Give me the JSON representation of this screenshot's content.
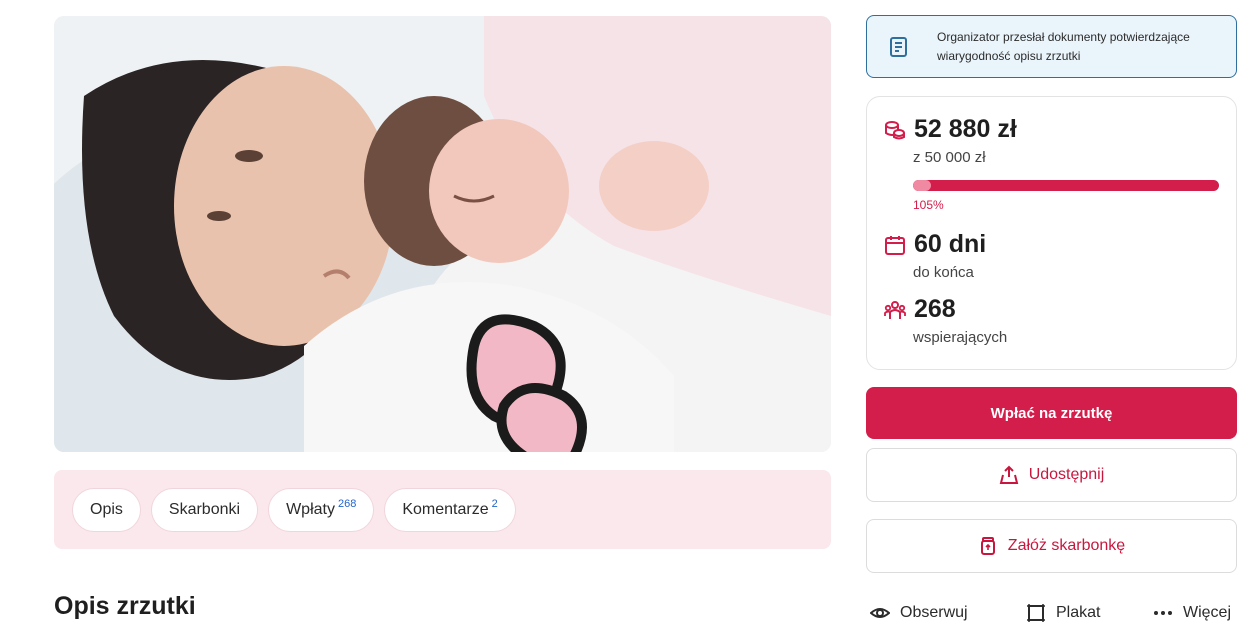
{
  "photo": {
    "subject": "photo-mother-with-newborn"
  },
  "tabs": [
    {
      "label": "Opis",
      "count": ""
    },
    {
      "label": "Skarbonki",
      "count": ""
    },
    {
      "label": "Wpłaty",
      "count": "268"
    },
    {
      "label": "Komentarze",
      "count": "2"
    }
  ],
  "section_title": "Opis zrzutki",
  "verification": {
    "text": "Organizator przesłał dokumenty potwierdzające wiarygodność opisu zrzutki",
    "icon": "document-icon"
  },
  "stats": {
    "raised": "52 880 zł",
    "goal": "z 50 000 zł",
    "progress_percent": 105,
    "progress_label": "105%",
    "days": "60 dni",
    "days_label": "do końca",
    "supporters": "268",
    "supporters_label": "wspierających"
  },
  "buttons": {
    "donate": "Wpłać na zrzutkę",
    "share": "Udostępnij",
    "piggybank": "Załóż skarbonkę"
  },
  "actions": {
    "follow": "Obserwuj",
    "poster": "Plakat",
    "more": "Więcej"
  },
  "colors": {
    "accent": "#d31d4a",
    "tabs_bg": "#fbe8ec",
    "verify_bg": "#eaf5fb",
    "verify_border": "#2f6f9e"
  }
}
